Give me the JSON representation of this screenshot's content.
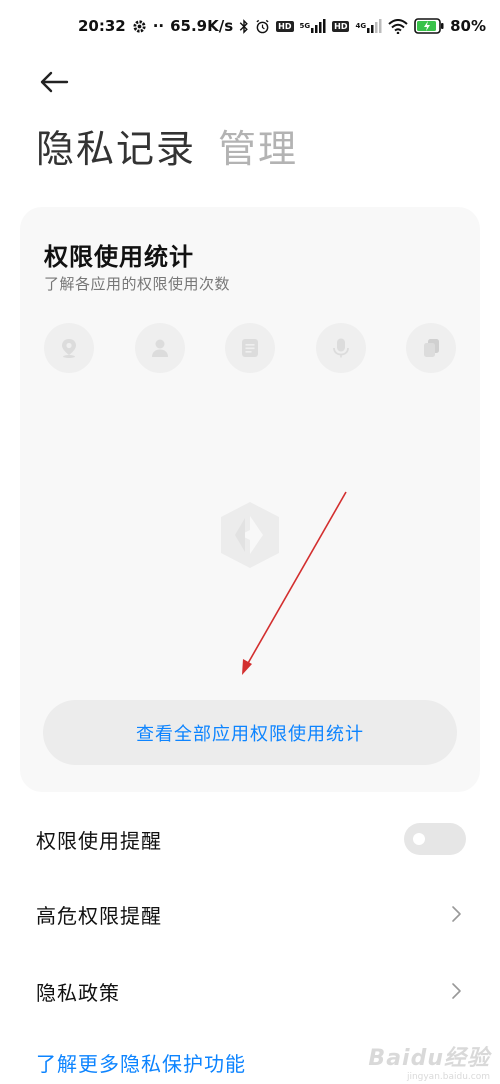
{
  "status_bar": {
    "time": "20:32",
    "dots": "··",
    "speed": "65.9K/s",
    "hd1": "HD",
    "net1": "5G",
    "hd2": "HD",
    "net2": "4G",
    "battery": "80%"
  },
  "header": {
    "title": "隐私记录",
    "tab_manage": "管理"
  },
  "card": {
    "title": "权限使用统计",
    "subtitle": "了解各应用的权限使用次数",
    "permission_icons": [
      "location-icon",
      "contacts-icon",
      "sms-icon",
      "microphone-icon",
      "clipboard-icon"
    ],
    "view_all_button": "查看全部应用权限使用统计"
  },
  "settings": {
    "permission_reminder": {
      "label": "权限使用提醒",
      "toggle_on": false
    },
    "high_risk_reminder": {
      "label": "高危权限提醒"
    },
    "privacy_policy": {
      "label": "隐私政策"
    }
  },
  "link_more": "了解更多隐私保护功能",
  "watermark": {
    "text": "Baidu经验",
    "sub": "jingyan.baidu.com"
  },
  "colors": {
    "accent": "#0d84ff",
    "card_bg": "#f8f8f8",
    "annotation_arrow": "#d32f2f"
  }
}
